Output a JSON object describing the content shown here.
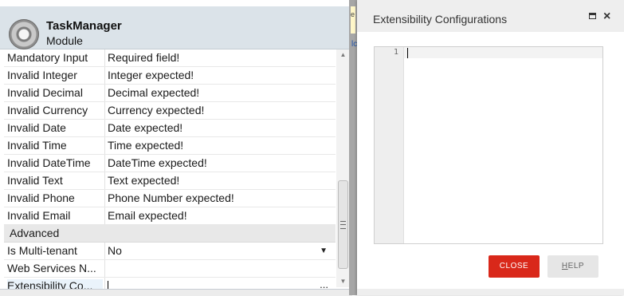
{
  "module": {
    "title": "TaskManager",
    "subtitle": "Module"
  },
  "properties": [
    {
      "name": "Mandatory Input",
      "value": "Required field!"
    },
    {
      "name": "Invalid Integer",
      "value": "Integer expected!"
    },
    {
      "name": "Invalid Decimal",
      "value": "Decimal expected!"
    },
    {
      "name": "Invalid Currency",
      "value": "Currency expected!"
    },
    {
      "name": "Invalid Date",
      "value": "Date expected!"
    },
    {
      "name": "Invalid Time",
      "value": "Time expected!"
    },
    {
      "name": "Invalid DateTime",
      "value": "DateTime expected!"
    },
    {
      "name": "Invalid Text",
      "value": "Text expected!"
    },
    {
      "name": "Invalid Phone",
      "value": "Phone Number expected!"
    },
    {
      "name": "Invalid Email",
      "value": "Email expected!"
    }
  ],
  "advanced": {
    "section_label": "Advanced",
    "multi_tenant": {
      "name": "Is Multi-tenant",
      "value": "No"
    },
    "web_services": {
      "name": "Web Services N...",
      "value": ""
    },
    "extensibility": {
      "name": "Extensibility Co...",
      "value": "",
      "button": "..."
    }
  },
  "background_fragments": {
    "top": "e",
    "link": "lc"
  },
  "dialog": {
    "title": "Extensibility Configurations",
    "editor": {
      "line_number": "1",
      "content": ""
    },
    "close_label": "CLOSE",
    "help_label_underlined": "H",
    "help_label_rest": "ELP",
    "close_color": "#d9281a"
  }
}
